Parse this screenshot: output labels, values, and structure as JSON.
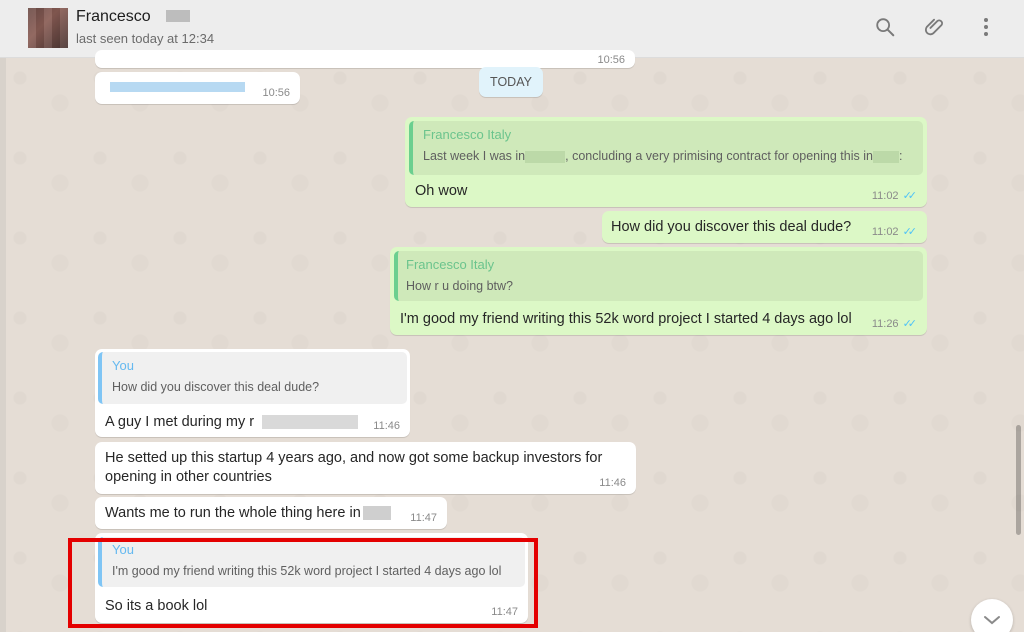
{
  "header": {
    "contact_name": "Francesco",
    "last_seen": "last seen today at 12:34",
    "icons": [
      "search-icon",
      "attach-icon",
      "menu-icon"
    ]
  },
  "chat": {
    "prev_messages": [
      {
        "time": "10:56"
      },
      {
        "time": "10:56"
      }
    ],
    "date_divider": "TODAY",
    "messages": [
      {
        "direction": "out",
        "quote_author": "Francesco Italy",
        "quote_text_a": "Last week I was in",
        "quote_text_b": ", concluding a very primising contract for opening this in",
        "quote_text_c": ":",
        "text": "Oh wow",
        "time": "11:02"
      },
      {
        "direction": "out",
        "text": "How did you discover this deal dude?",
        "time": "11:02"
      },
      {
        "direction": "out",
        "quote_author": "Francesco Italy",
        "quote_text": "How r u doing btw?",
        "text": "I'm good my friend writing this 52k word project I started 4 days ago lol",
        "time": "11:26"
      },
      {
        "direction": "in",
        "quote_author": "You",
        "quote_text": "How did you discover this deal dude?",
        "text": "A guy I met during my r",
        "time": "11:46"
      },
      {
        "direction": "in",
        "text_line1": "He setted up this startup 4 years ago, and now got some backup investors for",
        "text_line2": "opening in other countries",
        "time": "11:46"
      },
      {
        "direction": "in",
        "text": "Wants me to run the whole thing here in",
        "time": "11:47"
      },
      {
        "direction": "in",
        "quote_author": "You",
        "quote_text": "I'm good my friend writing this 52k word project I started 4 days ago lol",
        "text": "So its a book lol",
        "time": "11:47"
      }
    ]
  },
  "colors": {
    "outgoing_bubble": "#dcf8c6",
    "incoming_bubble": "#ffffff",
    "chat_background": "#e5ddd5",
    "highlight_box": "#e40000",
    "read_ticks": "#4fc3f7"
  }
}
